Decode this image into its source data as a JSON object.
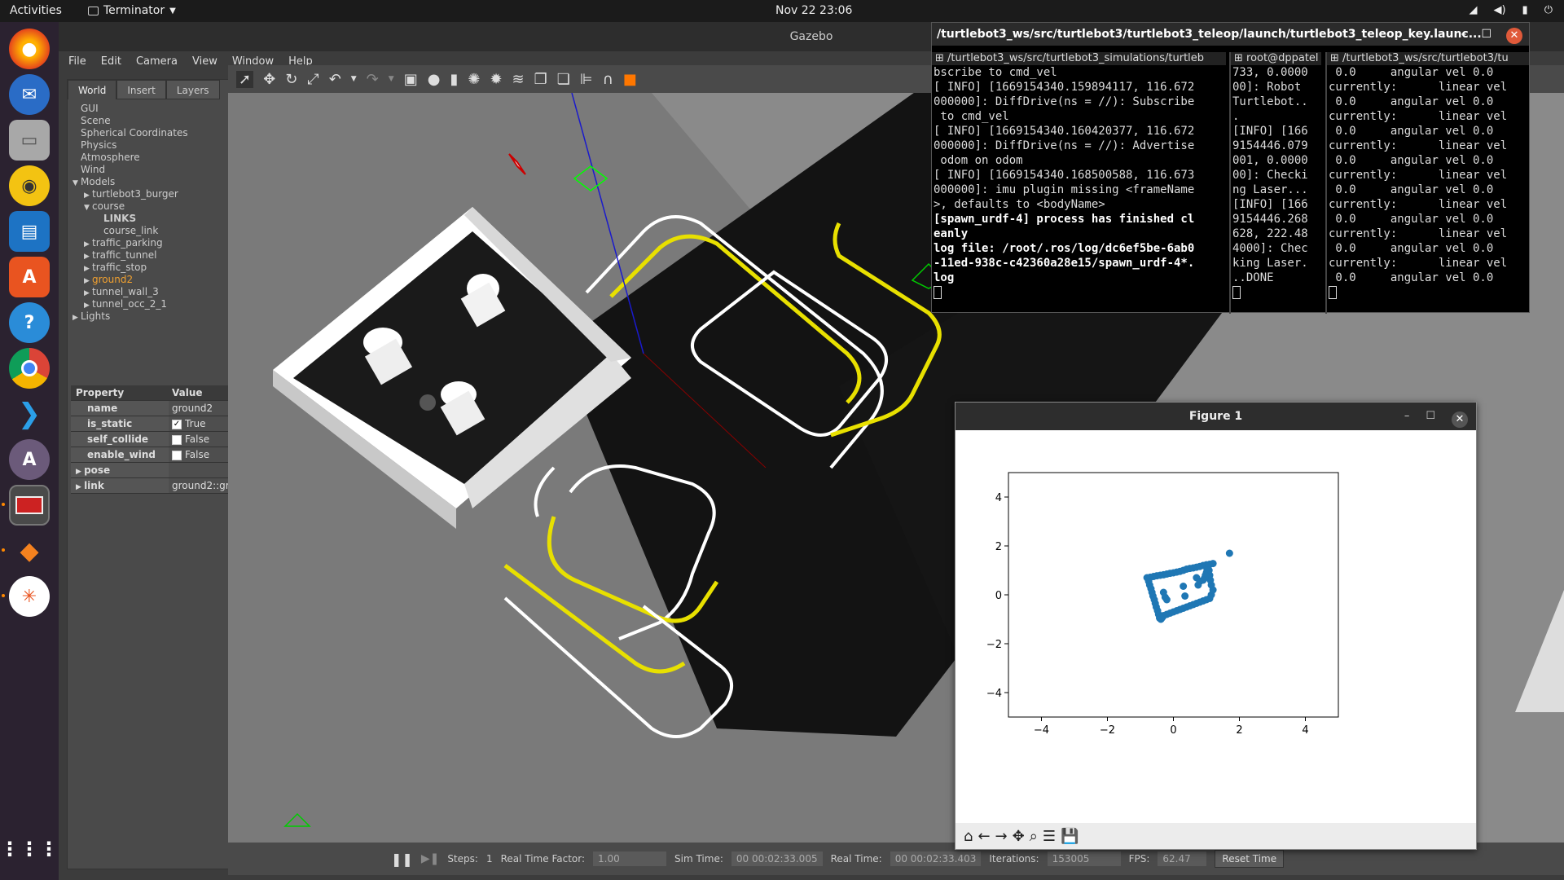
{
  "topbar": {
    "activities": "Activities",
    "app_name": "Terminator",
    "clock": "Nov 22  23:06"
  },
  "gazebo": {
    "title": "Gazebo",
    "menu": [
      "File",
      "Edit",
      "Camera",
      "View",
      "Window",
      "Help"
    ],
    "tabs": [
      "World",
      "Insert",
      "Layers"
    ],
    "tree": [
      {
        "label": "GUI",
        "indent": 0,
        "arrow": ""
      },
      {
        "label": "Scene",
        "indent": 0,
        "arrow": ""
      },
      {
        "label": "Spherical Coordinates",
        "indent": 0,
        "arrow": ""
      },
      {
        "label": "Physics",
        "indent": 0,
        "arrow": ""
      },
      {
        "label": "Atmosphere",
        "indent": 0,
        "arrow": ""
      },
      {
        "label": "Wind",
        "indent": 0,
        "arrow": ""
      },
      {
        "label": "Models",
        "indent": 0,
        "arrow": "down"
      },
      {
        "label": "turtlebot3_burger",
        "indent": 1,
        "arrow": "right"
      },
      {
        "label": "course",
        "indent": 1,
        "arrow": "down"
      },
      {
        "label": "LINKS",
        "indent": 2,
        "arrow": "",
        "bold": true
      },
      {
        "label": "course_link",
        "indent": 2,
        "arrow": ""
      },
      {
        "label": "traffic_parking",
        "indent": 1,
        "arrow": "right"
      },
      {
        "label": "traffic_tunnel",
        "indent": 1,
        "arrow": "right"
      },
      {
        "label": "traffic_stop",
        "indent": 1,
        "arrow": "right"
      },
      {
        "label": "ground2",
        "indent": 1,
        "arrow": "right",
        "selected": true
      },
      {
        "label": "tunnel_wall_3",
        "indent": 1,
        "arrow": "right"
      },
      {
        "label": "tunnel_occ_2_1",
        "indent": 1,
        "arrow": "right"
      },
      {
        "label": "Lights",
        "indent": 0,
        "arrow": "right"
      }
    ],
    "props_header": {
      "property": "Property",
      "value": "Value"
    },
    "props": [
      {
        "key": "name",
        "value": "ground2",
        "check": false,
        "expand": false
      },
      {
        "key": "is_static",
        "value": "True",
        "check": true,
        "checked": true,
        "expand": false
      },
      {
        "key": "self_collide",
        "value": "False",
        "check": true,
        "checked": false,
        "expand": false
      },
      {
        "key": "enable_wind",
        "value": "False",
        "check": true,
        "checked": false,
        "expand": false
      },
      {
        "key": "pose",
        "value": "",
        "check": false,
        "expand": true
      },
      {
        "key": "link",
        "value": "ground2::ground",
        "check": false,
        "expand": true
      }
    ],
    "bottom": {
      "steps_label": "Steps:",
      "steps_value": "1",
      "rtf_label": "Real Time Factor:",
      "rtf_value": "1.00",
      "sim_label": "Sim Time:",
      "sim_value": "00 00:02:33.005",
      "real_label": "Real Time:",
      "real_value": "00 00:02:33.403",
      "iter_label": "Iterations:",
      "iter_value": "153005",
      "fps_label": "FPS:",
      "fps_value": "62.47",
      "reset": "Reset Time"
    }
  },
  "terminal": {
    "title": "/turtlebot3_ws/src/turtlebot3/turtlebot3_teleop/launch/turtlebot3_teleop_key.launc...",
    "pane1_header": "/turtlebot3_ws/src/turtlebot3_simulations/turtleb",
    "pane1_lines": [
      "bscribe to cmd_vel",
      "[ INFO] [1669154340.159894117, 116.672",
      "000000]: DiffDrive(ns = //): Subscribe",
      " to cmd_vel",
      "[ INFO] [1669154340.160420377, 116.672",
      "000000]: DiffDrive(ns = //): Advertise",
      " odom on odom",
      "[ INFO] [1669154340.168500588, 116.673",
      "000000]: imu plugin missing <frameName",
      ">, defaults to <bodyName>"
    ],
    "pane1_bold": [
      "[spawn_urdf-4] process has finished cl",
      "eanly",
      "log file: /root/.ros/log/dc6ef5be-6ab0",
      "-11ed-938c-c42360a28e15/spawn_urdf-4*.",
      "log"
    ],
    "pane2_header": "root@dppatel",
    "pane2_lines": [
      "733, 0.0000",
      "00]: Robot",
      "Turtlebot..",
      ".",
      "[INFO] [166",
      "9154446.079",
      "001, 0.0000",
      "00]: Checki",
      "ng Laser...",
      "[INFO] [166",
      "9154446.268",
      "628, 222.48",
      "4000]: Chec",
      "king Laser.",
      "..DONE"
    ],
    "pane3_header": "/turtlebot3_ws/src/turtlebot3/tu",
    "pane3_lines": [
      " 0.0     angular vel 0.0",
      "currently:      linear vel",
      " 0.0     angular vel 0.0",
      "currently:      linear vel",
      " 0.0     angular vel 0.0",
      "currently:      linear vel",
      " 0.0     angular vel 0.0",
      "currently:      linear vel",
      " 0.0     angular vel 0.0",
      "currently:      linear vel",
      " 0.0     angular vel 0.0",
      "currently:      linear vel",
      " 0.0     angular vel 0.0",
      "currently:      linear vel",
      " 0.0     angular vel 0.0"
    ]
  },
  "figure": {
    "title": "Figure 1",
    "toolbar_icons": [
      "home-icon",
      "back-icon",
      "forward-icon",
      "pan-icon",
      "zoom-icon",
      "configure-icon",
      "save-icon"
    ]
  },
  "chart_data": {
    "type": "scatter",
    "title": "",
    "xlabel": "",
    "ylabel": "",
    "xlim": [
      -5,
      5
    ],
    "ylim": [
      -5,
      5
    ],
    "xticks": [
      "−4",
      "−2",
      "0",
      "2",
      "4"
    ],
    "yticks": [
      "4",
      "2",
      "0",
      "−2",
      "−4"
    ],
    "color": "#1f77b4",
    "x": [
      -0.8,
      -0.7,
      -0.6,
      -0.5,
      -0.4,
      -0.3,
      -0.2,
      -0.1,
      0.0,
      0.1,
      0.2,
      0.3,
      0.4,
      0.5,
      0.6,
      0.7,
      0.8,
      0.9,
      1.0,
      1.1,
      1.2,
      -0.75,
      -0.72,
      -0.68,
      -0.65,
      -0.62,
      -0.58,
      -0.55,
      -0.52,
      -0.48,
      -0.45,
      -0.42,
      -0.38,
      -0.35,
      -0.32,
      -0.3,
      -0.2,
      -0.1,
      0.0,
      0.1,
      0.2,
      0.3,
      0.4,
      0.5,
      0.6,
      0.7,
      0.8,
      0.9,
      1.0,
      1.1,
      1.15,
      1.2,
      1.15,
      1.12,
      1.1,
      1.08,
      1.05,
      1.02,
      1.0,
      0.97,
      0.95,
      -0.3,
      -0.25,
      -0.2,
      0.3,
      0.35,
      0.7,
      0.75,
      0.8,
      0.9,
      1.7
    ],
    "y": [
      0.7,
      0.72,
      0.75,
      0.78,
      0.8,
      0.82,
      0.85,
      0.88,
      0.9,
      0.93,
      0.96,
      1.0,
      1.05,
      1.08,
      1.1,
      1.13,
      1.16,
      1.2,
      1.23,
      1.25,
      1.28,
      0.55,
      0.4,
      0.25,
      0.1,
      -0.05,
      -0.2,
      -0.35,
      -0.5,
      -0.65,
      -0.8,
      -0.95,
      -1.0,
      -0.95,
      -0.9,
      -0.85,
      -0.8,
      -0.75,
      -0.7,
      -0.65,
      -0.6,
      -0.55,
      -0.5,
      -0.45,
      -0.4,
      -0.35,
      -0.3,
      -0.25,
      -0.2,
      -0.15,
      0.0,
      0.2,
      0.4,
      0.6,
      0.8,
      1.0,
      1.1,
      1.0,
      0.9,
      0.8,
      0.7,
      0.1,
      -0.1,
      -0.2,
      0.35,
      -0.05,
      0.7,
      0.4,
      0.55,
      0.6,
      1.7
    ]
  }
}
